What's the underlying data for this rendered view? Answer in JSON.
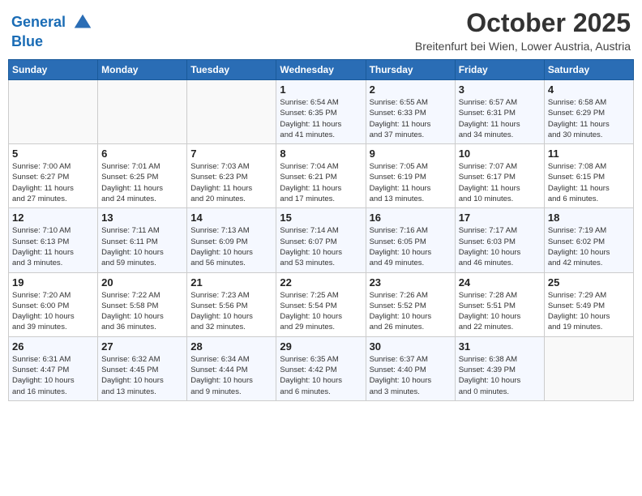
{
  "header": {
    "logo_line1": "General",
    "logo_line2": "Blue",
    "month": "October 2025",
    "location": "Breitenfurt bei Wien, Lower Austria, Austria"
  },
  "days_of_week": [
    "Sunday",
    "Monday",
    "Tuesday",
    "Wednesday",
    "Thursday",
    "Friday",
    "Saturday"
  ],
  "weeks": [
    [
      {
        "day": "",
        "info": ""
      },
      {
        "day": "",
        "info": ""
      },
      {
        "day": "",
        "info": ""
      },
      {
        "day": "1",
        "info": "Sunrise: 6:54 AM\nSunset: 6:35 PM\nDaylight: 11 hours\nand 41 minutes."
      },
      {
        "day": "2",
        "info": "Sunrise: 6:55 AM\nSunset: 6:33 PM\nDaylight: 11 hours\nand 37 minutes."
      },
      {
        "day": "3",
        "info": "Sunrise: 6:57 AM\nSunset: 6:31 PM\nDaylight: 11 hours\nand 34 minutes."
      },
      {
        "day": "4",
        "info": "Sunrise: 6:58 AM\nSunset: 6:29 PM\nDaylight: 11 hours\nand 30 minutes."
      }
    ],
    [
      {
        "day": "5",
        "info": "Sunrise: 7:00 AM\nSunset: 6:27 PM\nDaylight: 11 hours\nand 27 minutes."
      },
      {
        "day": "6",
        "info": "Sunrise: 7:01 AM\nSunset: 6:25 PM\nDaylight: 11 hours\nand 24 minutes."
      },
      {
        "day": "7",
        "info": "Sunrise: 7:03 AM\nSunset: 6:23 PM\nDaylight: 11 hours\nand 20 minutes."
      },
      {
        "day": "8",
        "info": "Sunrise: 7:04 AM\nSunset: 6:21 PM\nDaylight: 11 hours\nand 17 minutes."
      },
      {
        "day": "9",
        "info": "Sunrise: 7:05 AM\nSunset: 6:19 PM\nDaylight: 11 hours\nand 13 minutes."
      },
      {
        "day": "10",
        "info": "Sunrise: 7:07 AM\nSunset: 6:17 PM\nDaylight: 11 hours\nand 10 minutes."
      },
      {
        "day": "11",
        "info": "Sunrise: 7:08 AM\nSunset: 6:15 PM\nDaylight: 11 hours\nand 6 minutes."
      }
    ],
    [
      {
        "day": "12",
        "info": "Sunrise: 7:10 AM\nSunset: 6:13 PM\nDaylight: 11 hours\nand 3 minutes."
      },
      {
        "day": "13",
        "info": "Sunrise: 7:11 AM\nSunset: 6:11 PM\nDaylight: 10 hours\nand 59 minutes."
      },
      {
        "day": "14",
        "info": "Sunrise: 7:13 AM\nSunset: 6:09 PM\nDaylight: 10 hours\nand 56 minutes."
      },
      {
        "day": "15",
        "info": "Sunrise: 7:14 AM\nSunset: 6:07 PM\nDaylight: 10 hours\nand 53 minutes."
      },
      {
        "day": "16",
        "info": "Sunrise: 7:16 AM\nSunset: 6:05 PM\nDaylight: 10 hours\nand 49 minutes."
      },
      {
        "day": "17",
        "info": "Sunrise: 7:17 AM\nSunset: 6:03 PM\nDaylight: 10 hours\nand 46 minutes."
      },
      {
        "day": "18",
        "info": "Sunrise: 7:19 AM\nSunset: 6:02 PM\nDaylight: 10 hours\nand 42 minutes."
      }
    ],
    [
      {
        "day": "19",
        "info": "Sunrise: 7:20 AM\nSunset: 6:00 PM\nDaylight: 10 hours\nand 39 minutes."
      },
      {
        "day": "20",
        "info": "Sunrise: 7:22 AM\nSunset: 5:58 PM\nDaylight: 10 hours\nand 36 minutes."
      },
      {
        "day": "21",
        "info": "Sunrise: 7:23 AM\nSunset: 5:56 PM\nDaylight: 10 hours\nand 32 minutes."
      },
      {
        "day": "22",
        "info": "Sunrise: 7:25 AM\nSunset: 5:54 PM\nDaylight: 10 hours\nand 29 minutes."
      },
      {
        "day": "23",
        "info": "Sunrise: 7:26 AM\nSunset: 5:52 PM\nDaylight: 10 hours\nand 26 minutes."
      },
      {
        "day": "24",
        "info": "Sunrise: 7:28 AM\nSunset: 5:51 PM\nDaylight: 10 hours\nand 22 minutes."
      },
      {
        "day": "25",
        "info": "Sunrise: 7:29 AM\nSunset: 5:49 PM\nDaylight: 10 hours\nand 19 minutes."
      }
    ],
    [
      {
        "day": "26",
        "info": "Sunrise: 6:31 AM\nSunset: 4:47 PM\nDaylight: 10 hours\nand 16 minutes."
      },
      {
        "day": "27",
        "info": "Sunrise: 6:32 AM\nSunset: 4:45 PM\nDaylight: 10 hours\nand 13 minutes."
      },
      {
        "day": "28",
        "info": "Sunrise: 6:34 AM\nSunset: 4:44 PM\nDaylight: 10 hours\nand 9 minutes."
      },
      {
        "day": "29",
        "info": "Sunrise: 6:35 AM\nSunset: 4:42 PM\nDaylight: 10 hours\nand 6 minutes."
      },
      {
        "day": "30",
        "info": "Sunrise: 6:37 AM\nSunset: 4:40 PM\nDaylight: 10 hours\nand 3 minutes."
      },
      {
        "day": "31",
        "info": "Sunrise: 6:38 AM\nSunset: 4:39 PM\nDaylight: 10 hours\nand 0 minutes."
      },
      {
        "day": "",
        "info": ""
      }
    ]
  ]
}
